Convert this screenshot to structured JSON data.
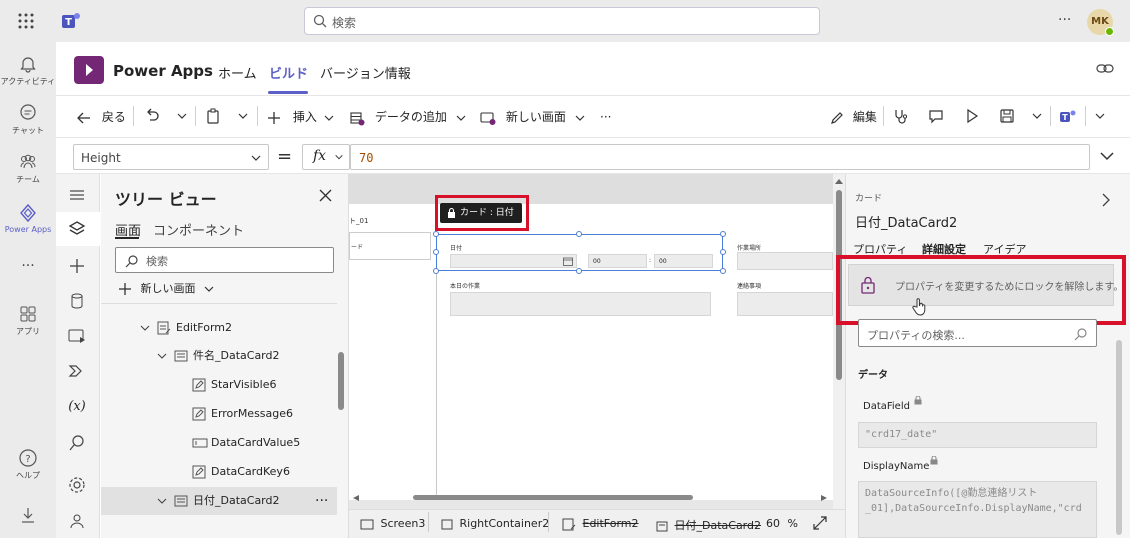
{
  "teams": {
    "search_placeholder": "検索",
    "avatar_initials": "MK",
    "rail": [
      {
        "label": "アクティビティ",
        "icon": "bell-icon"
      },
      {
        "label": "チャット",
        "icon": "chat-icon"
      },
      {
        "label": "チーム",
        "icon": "teams-icon"
      },
      {
        "label": "Power Apps",
        "icon": "power-apps-icon"
      },
      {
        "label": "アプリ",
        "icon": "apps-icon"
      },
      {
        "label": "ヘルプ",
        "icon": "help-icon"
      }
    ]
  },
  "app": {
    "title": "Power Apps",
    "tabs": [
      "ホーム",
      "ビルド",
      "バージョン情報"
    ],
    "active_tab": "ビルド"
  },
  "commands": {
    "back": "戻る",
    "insert": "挿入",
    "add_data": "データの追加",
    "new_screen": "新しい画面",
    "more": "···",
    "edit": "編集"
  },
  "formula_bar": {
    "property": "Height",
    "equals": "=",
    "fx": "fx",
    "value": "70"
  },
  "tree": {
    "title": "ツリー ビュー",
    "tabs": [
      "画面",
      "コンポーネント"
    ],
    "search_placeholder": "検索",
    "new_screen": "新しい画面",
    "nodes": [
      {
        "label": "EditForm2"
      },
      {
        "label": "件名_DataCard2"
      },
      {
        "label": "StarVisible6"
      },
      {
        "label": "ErrorMessage6"
      },
      {
        "label": "DataCardValue5"
      },
      {
        "label": "DataCardKey6"
      },
      {
        "label": "日付_DataCard2"
      }
    ]
  },
  "canvas": {
    "header_text": "ト_01",
    "left_field_text": "ード",
    "card_tooltip": "カード : 日付",
    "field_date_label": "日付",
    "time_hour": "00",
    "time_min": "00",
    "field_location_label": "作業場所",
    "field_work_label": "本日の作業",
    "field_contact_label": "連絡事項",
    "zoom": "60",
    "zoom_unit": "%"
  },
  "breadcrumb": [
    "Screen3",
    "RightContainer2",
    "EditForm2",
    "日付_DataCard2"
  ],
  "properties_panel": {
    "kind": "カード",
    "name": "日付_DataCard2",
    "tabs": [
      "プロパティ",
      "詳細設定",
      "アイデア"
    ],
    "active_tab": "詳細設定",
    "lock_message": "プロパティを変更するためにロックを解除します。",
    "search_placeholder": "プロパティの検索...",
    "section": "データ",
    "datafield_label": "DataField",
    "datafield_value": "\"crd17_date\"",
    "displayname_label": "DisplayName",
    "displayname_value_1": "DataSourceInfo([@勤怠連絡リスト",
    "displayname_value_2": "_01],DataSourceInfo.DisplayName,\"crd"
  },
  "colors": {
    "accent": "#5b5fc7",
    "power_apps_purple": "#742774",
    "highlight_red": "#d9102a"
  }
}
